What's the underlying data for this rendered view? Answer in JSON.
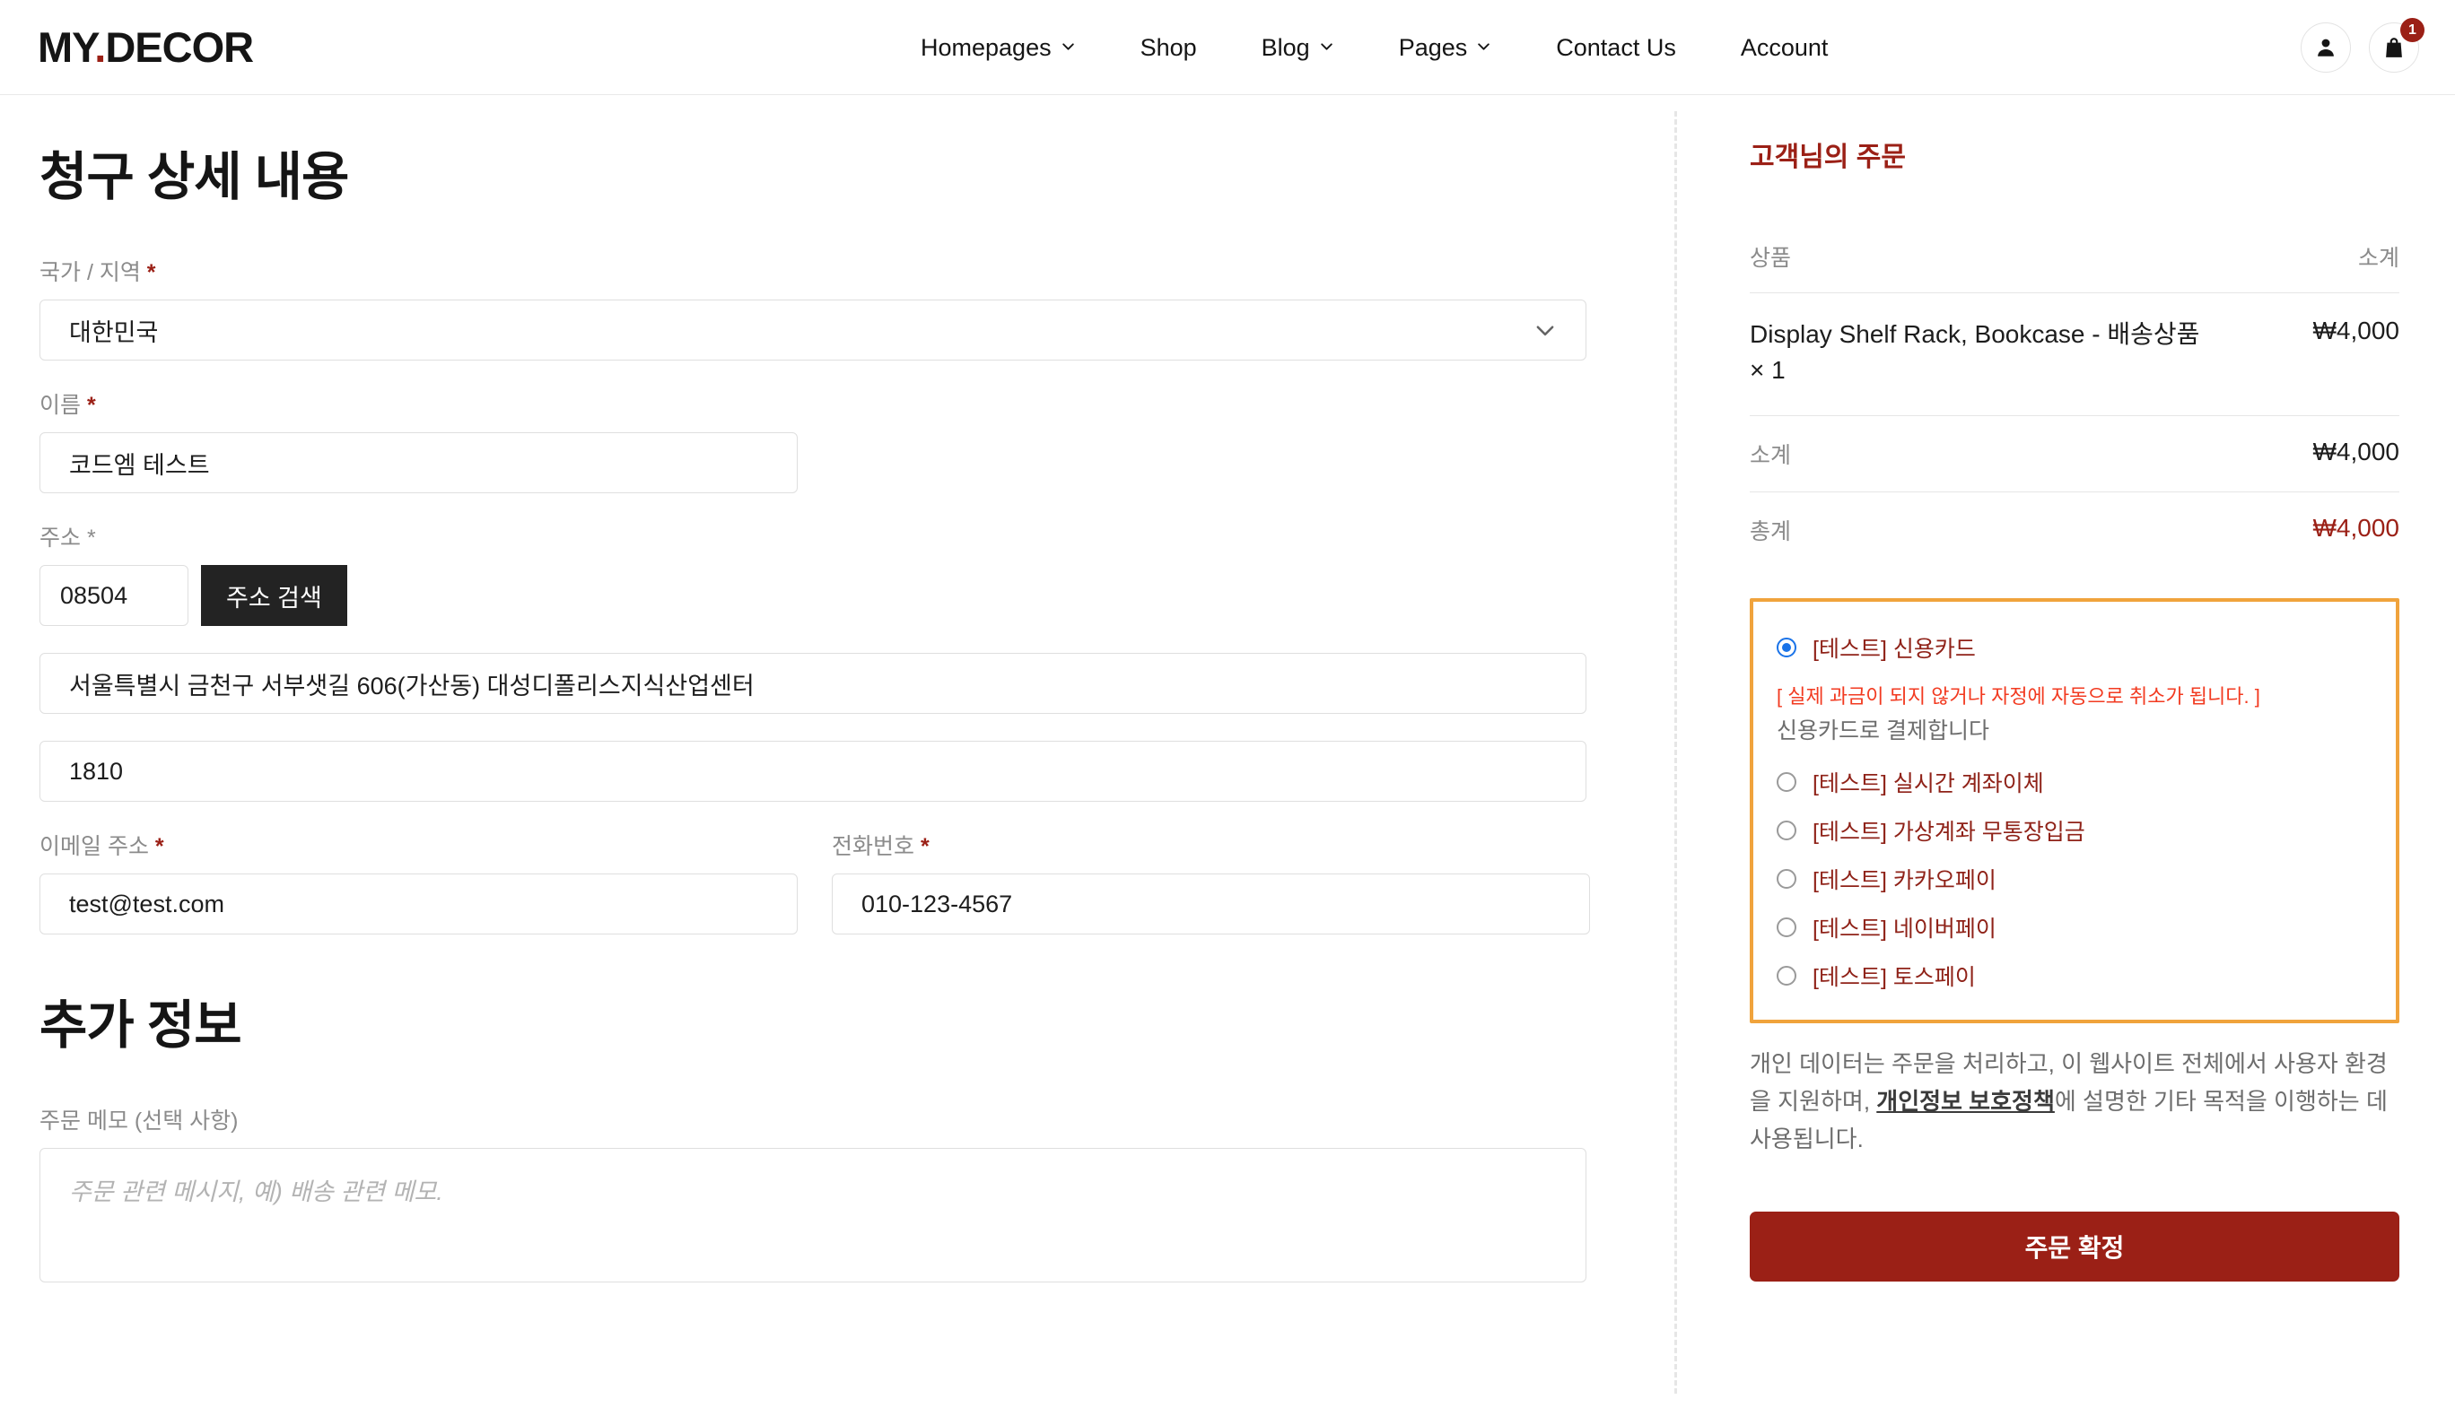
{
  "header": {
    "logo_main": "MY",
    "logo_dot": ".",
    "logo_sub": "DECOR",
    "nav": [
      {
        "label": "Homepages",
        "has_chevron": true
      },
      {
        "label": "Shop",
        "has_chevron": false
      },
      {
        "label": "Blog",
        "has_chevron": true
      },
      {
        "label": "Pages",
        "has_chevron": true
      },
      {
        "label": "Contact Us",
        "has_chevron": false
      },
      {
        "label": "Account",
        "has_chevron": false
      }
    ],
    "account_icon": "user-icon",
    "cart_icon": "shopping-bag-icon",
    "cart_count": "1"
  },
  "billing": {
    "title": "청구 상세 내용",
    "country": {
      "label": "국가 / 지역",
      "required_mark": "*",
      "value": "대한민국",
      "chevron_icon": "chevron-down-icon"
    },
    "name": {
      "label": "이름",
      "required_mark": "*",
      "value": "코드엠 테스트"
    },
    "address": {
      "label": "주소",
      "required_mark": "*",
      "zip_value": "08504",
      "search_button": "주소 검색",
      "line1_value": "서울특별시 금천구 서부샛길 606(가산동) 대성디폴리스지식산업센터",
      "line2_value": "1810"
    },
    "email": {
      "label": "이메일 주소",
      "required_mark": "*",
      "value": "test@test.com"
    },
    "phone": {
      "label": "전화번호",
      "required_mark": "*",
      "value": "010-123-4567"
    }
  },
  "additional": {
    "title": "추가 정보",
    "note_label": "주문 메모 (선택 사항)",
    "note_placeholder": "주문 관련 메시지, 예) 배송 관련 메모.",
    "note_value": ""
  },
  "order": {
    "title": "고객님의 주문",
    "col_product": "상품",
    "col_subtotal": "소계",
    "items": [
      {
        "name": "Display Shelf Rack, Bookcase - 배송상품  × 1",
        "price": "₩4,000"
      }
    ],
    "subtotal_label": "소계",
    "subtotal_value": "₩4,000",
    "total_label": "총계",
    "total_value": "₩4,000"
  },
  "payment": {
    "options": [
      {
        "label": "[테스트] 신용카드",
        "selected": true
      },
      {
        "label": "[테스트] 실시간 계좌이체",
        "selected": false
      },
      {
        "label": "[테스트] 가상계좌 무통장입금",
        "selected": false
      },
      {
        "label": "[테스트] 카카오페이",
        "selected": false
      },
      {
        "label": "[테스트] 네이버페이",
        "selected": false
      },
      {
        "label": "[테스트] 토스페이",
        "selected": false
      }
    ],
    "warning": "[ 실제 과금이 되지 않거나 자정에 자동으로 취소가 됩니다. ]",
    "description": "신용카드로 결제합니다",
    "privacy_before": "개인 데이터는 주문을 처리하고, 이 웹사이트 전체에서 사용자 환경을 지원하며, ",
    "privacy_link": "개인정보 보호정책",
    "privacy_after": "에 설명한 기타 목적을 이행하는 데 사용됩니다.",
    "submit_label": "주문 확정"
  },
  "colors": {
    "brand_red": "#9b2016",
    "payment_box_border": "#f0a33c",
    "warning_red": "#f23a20",
    "radio_blue": "#1a73e8"
  }
}
